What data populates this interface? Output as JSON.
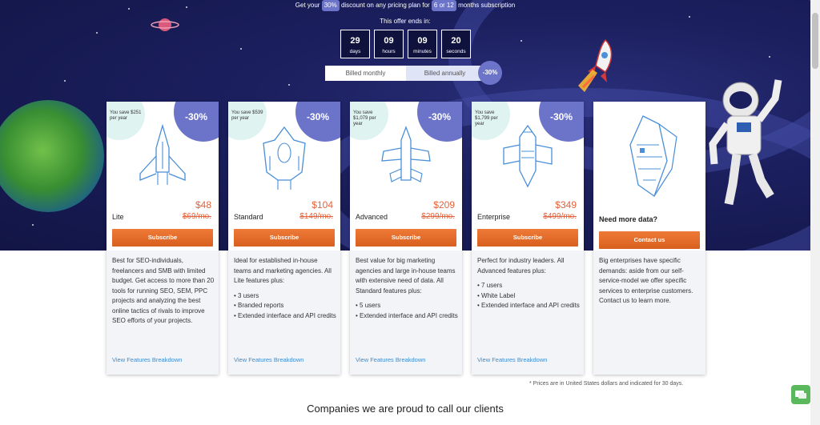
{
  "promo": {
    "prefix": "Get your",
    "discount": "30%",
    "middle": "discount on any pricing plan for",
    "period": "6 or 12",
    "suffix": "months subscription"
  },
  "countdown": {
    "title": "This offer ends in:",
    "units": [
      {
        "value": "29",
        "label": "days"
      },
      {
        "value": "09",
        "label": "hours"
      },
      {
        "value": "09",
        "label": "minutes"
      },
      {
        "value": "20",
        "label": "seconds"
      }
    ]
  },
  "billing": {
    "monthly_label": "Billed monthly",
    "annually_label": "Billed annually",
    "discount_badge": "-30%"
  },
  "plans": [
    {
      "save_text": "You save $251 per year",
      "discount": "-30%",
      "price": "$48",
      "name": "Lite",
      "old_price": "$69/mo.",
      "button": "Subscribe",
      "description": "Best for SEO-individuals, freelancers and SMB with limited budget. Get access to more than 20 tools for running SEO, SEM, PPC projects and analyzing the best online tactics of rivals to improve SEO efforts of your projects.",
      "features": [],
      "link": "View Features Breakdown"
    },
    {
      "save_text": "You save $539 per year",
      "discount": "-30%",
      "price": "$104",
      "name": "Standard",
      "old_price": "$149/mo.",
      "button": "Subscribe",
      "description": "Ideal for established in-house teams and marketing agencies. All Lite features plus:",
      "features": [
        "3 users",
        "Branded reports",
        "Extended interface and API credits"
      ],
      "link": "View Features Breakdown"
    },
    {
      "save_text": "You save $1,079 per year",
      "discount": "-30%",
      "price": "$209",
      "name": "Advanced",
      "old_price": "$299/mo.",
      "button": "Subscribe",
      "description": "Best value for big marketing agencies and large in-house teams with extensive need of data. All Standard features plus:",
      "features": [
        "5 users",
        "Extended interface and API credits"
      ],
      "link": "View Features Breakdown"
    },
    {
      "save_text": "You save $1,799 per year",
      "discount": "-30%",
      "price": "$349",
      "name": "Enterprise",
      "old_price": "$499/mo.",
      "button": "Subscribe",
      "description": "Perfect for industry leaders. All Advanced features plus:",
      "features": [
        "7 users",
        "White Label",
        "Extended interface and API credits"
      ],
      "link": "View Features Breakdown"
    }
  ],
  "custom_plan": {
    "title": "Need more data?",
    "button": "Contact us",
    "description": "Big enterprises have specific demands: aside from our self-service-model we offer specific services to enterprise customers. Contact us to learn more."
  },
  "footnote": "* Prices are in United States dollars and indicated for 30 days.",
  "clients_heading": "Companies we are proud to call our clients",
  "colors": {
    "accent": "#6b74c9",
    "price": "#e2633d",
    "button": "#e56d2a",
    "link": "#3a8bd0",
    "hero": "#1b1f5e"
  }
}
